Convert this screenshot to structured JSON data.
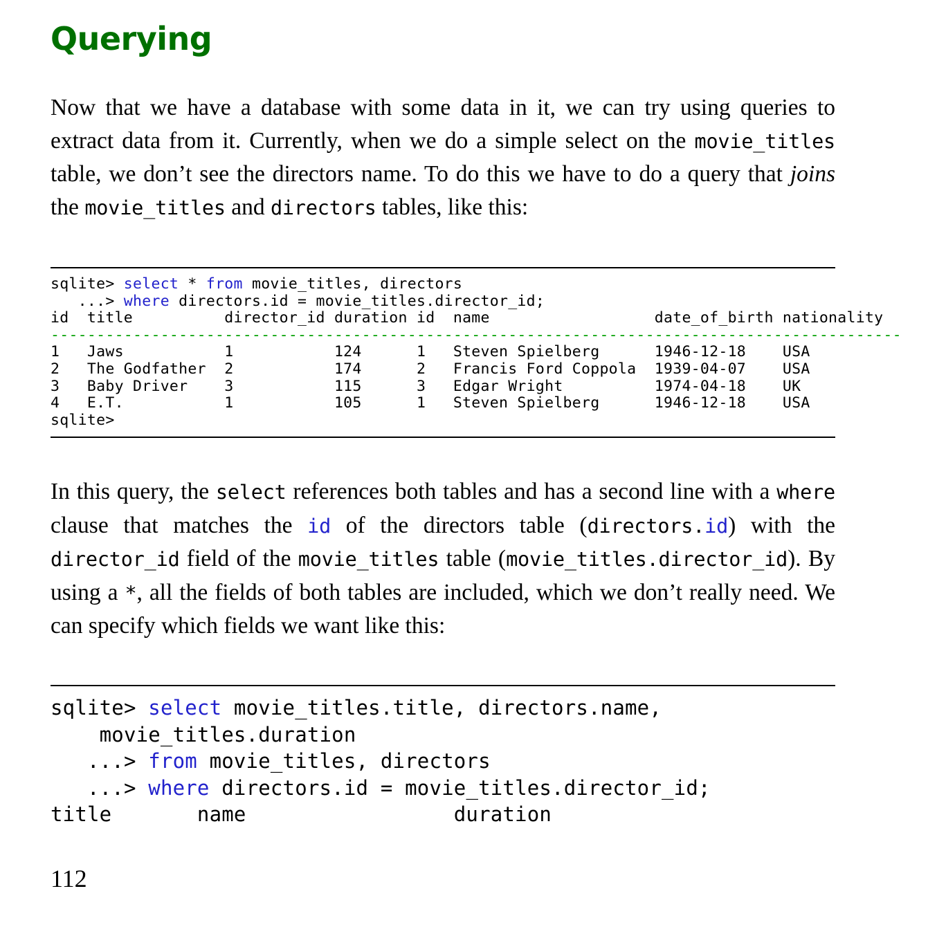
{
  "page": {
    "number": "112",
    "heading": "Querying"
  },
  "paragraphs": {
    "p1": {
      "s1": "Now that we have a database with some data in it, we can try using queries to extract data from it.  Currently, when we do a simple select on the ",
      "c1": "movie_titles",
      "s2": " table, we don’t see the directors name. To do this we have to do a query that ",
      "i1": "joins",
      "s3": " the ",
      "c2": "movie_titles",
      "s4": " and ",
      "c3": "directors",
      "s5": " tables, like this:"
    },
    "p2": {
      "s1": "In this query, the ",
      "c1": "select",
      "s2": " references both tables and has a second line with a ",
      "c2": "where",
      "s3": " clause that matches the ",
      "c3": "id",
      "s4": " of the directors table (",
      "c4a": "directors.",
      "c4b": "id",
      "s5": ") with the ",
      "c5": "director_id",
      "s6": " field of the ",
      "c6": "movie_titles",
      "s7": " table (",
      "c7": "movie_titles.director_id",
      "s8": ").  By using a ",
      "c8": "*",
      "s9": ", all the fields of both tables are included, which we don’t really need.  We can specify which fields we want like this:"
    }
  },
  "code_block_1": {
    "prompt1": "sqlite> ",
    "kw1": "select",
    "line1_rest": " * ",
    "kw2": "from",
    "line1_tail": " movie_titles, directors",
    "prompt2": "   ...> ",
    "kw3": "where",
    "line2_tail": " directors.id = movie_titles.director_id;",
    "header": "id  title          director_id duration id  name                  date_of_birth nationality",
    "separator": "---------------------------------------------------------------------------------------------",
    "rows": [
      "1   Jaws           1           124      1   Steven Spielberg      1946-12-18    USA",
      "2   The Godfather  2           174      2   Francis Ford Coppola  1939-04-07    USA",
      "3   Baby Driver    3           115      3   Edgar Wright          1974-04-18    UK",
      "4   E.T.           1           105      1   Steven Spielberg      1946-12-18    USA"
    ],
    "trailing_prompt": "sqlite>"
  },
  "code_block_2": {
    "prompt1": "sqlite> ",
    "kw1": "select",
    "line1_tail": " movie_titles.title, directors.name,",
    "line2": "    movie_titles.duration",
    "prompt2": "   ...> ",
    "kw2": "from",
    "line3_tail": " movie_titles, directors",
    "prompt3": "   ...> ",
    "kw3": "where",
    "line4_tail": " directors.id = movie_titles.director_id;",
    "header": "title       name                 duration"
  },
  "colors": {
    "heading_green": "#007000",
    "keyword_blue": "#2222cc",
    "separator_green": "#00a000",
    "text_black": "#000000",
    "rule_black": "#000000"
  }
}
